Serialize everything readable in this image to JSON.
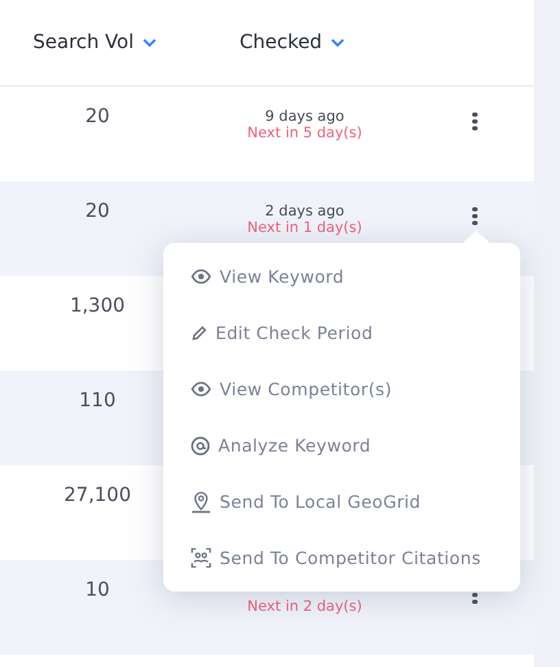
{
  "table": {
    "columns": [
      {
        "label": "Search Vol"
      },
      {
        "label": "Checked"
      }
    ],
    "rows": [
      {
        "search_vol": "20",
        "checked_ago": "9 days ago",
        "next_check": "Next in 5 day(s)",
        "has_menu": true
      },
      {
        "search_vol": "20",
        "checked_ago": "2 days ago",
        "next_check": "Next in 1 day(s)",
        "has_menu": true
      },
      {
        "search_vol": "1,300",
        "has_menu": false
      },
      {
        "search_vol": "110",
        "has_menu": false
      },
      {
        "search_vol": "27,100",
        "has_menu": false
      },
      {
        "search_vol": "10",
        "next_check": "Next in 2 day(s)",
        "has_menu": true
      }
    ]
  },
  "context_menu": {
    "items": [
      {
        "label": "View Keyword",
        "kind": "eye"
      },
      {
        "label": "Edit Check Period",
        "kind": "pencil"
      },
      {
        "label": "View Competitor(s)",
        "kind": "eye"
      },
      {
        "label": "Analyze Keyword",
        "kind": "at"
      },
      {
        "label": "Send To Local GeoGrid",
        "kind": "pin"
      },
      {
        "label": "Send To Competitor Citations",
        "kind": "people"
      }
    ]
  }
}
